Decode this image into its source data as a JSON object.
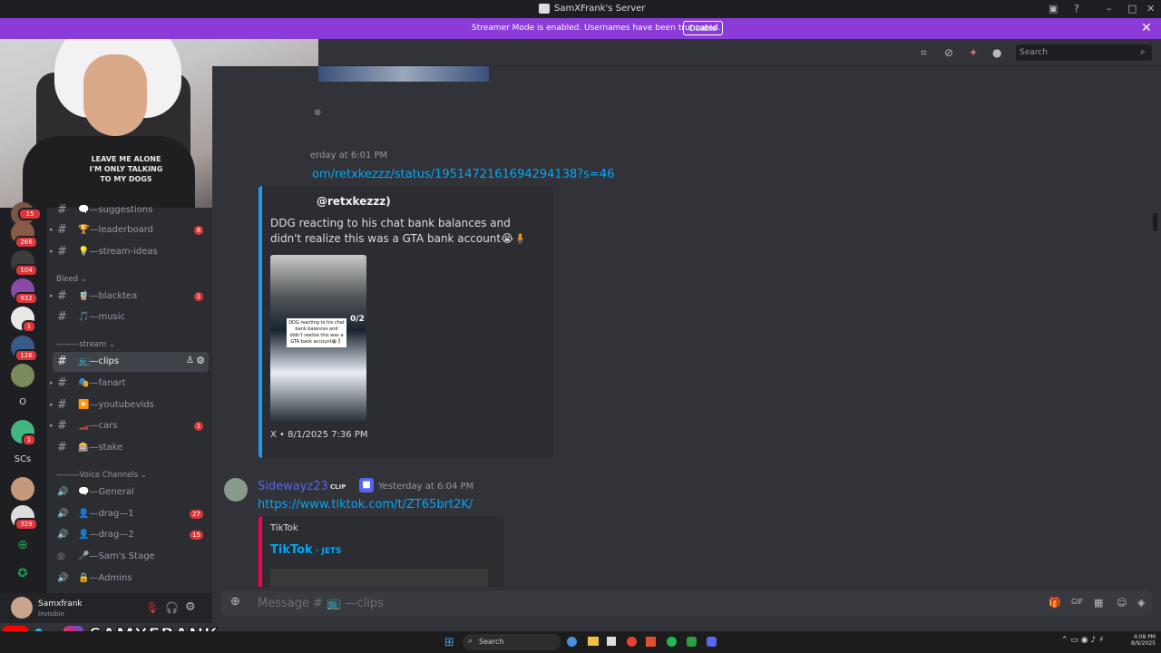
{
  "window": {
    "title": "SamXFrank's Server"
  },
  "banner": {
    "message": "Streamer Mode is enabled. Usernames have been truncated.",
    "button": "Disable"
  },
  "topbar": {
    "search_placeholder": "Search"
  },
  "servers": [
    {
      "badge": "15"
    },
    {
      "badge": "266"
    },
    {
      "badge": "104"
    },
    {
      "badge": "932"
    },
    {
      "badge": "1"
    },
    {
      "badge": "126"
    },
    {
      "badge": ""
    },
    {
      "label": "O"
    },
    {
      "badge": "1"
    },
    {
      "label": "SCs"
    },
    {
      "badge": ""
    },
    {
      "badge": "329"
    }
  ],
  "channels": [
    {
      "name": "🗨️—suggestions",
      "badge": ""
    },
    {
      "name": "🏆—leaderboard",
      "badge": "8"
    },
    {
      "name": "💡—stream-ideas",
      "badge": ""
    },
    {
      "name": "🧋—blacktea",
      "badge": "1"
    },
    {
      "name": "🎵—music",
      "badge": ""
    },
    {
      "name": "📺—clips",
      "badge": ""
    },
    {
      "name": "🎭—fanart",
      "badge": ""
    },
    {
      "name": "▶️—youtubevids",
      "badge": ""
    },
    {
      "name": "🏎️—cars",
      "badge": "1"
    },
    {
      "name": "🎰—stake",
      "badge": ""
    }
  ],
  "categories": {
    "bleed": "Bleed",
    "stream": "———stream",
    "voice": "———Voice Channels"
  },
  "voice": [
    {
      "name": "🗨️—General",
      "badge": ""
    },
    {
      "name": "👤—drag—1",
      "badge": "27"
    },
    {
      "name": "👤—drag—2",
      "badge": "15"
    },
    {
      "name": "🎤—Sam's Stage",
      "badge": ""
    },
    {
      "name": "🔒—Admins",
      "badge": ""
    }
  ],
  "user": {
    "name": "Samxfrank",
    "status": "Invisible"
  },
  "messages": {
    "m1": {
      "time": "erday at 6:01 PM",
      "link": "om/retxkezzz/status/1951472161694294138?s=46",
      "embed_author": "@retxkezzz)",
      "embed_text": "DDG reacting to his chat bank balances and didn't realize this was a GTA bank account😭🧍",
      "footer": "X • 8/1/2025 7:36 PM"
    },
    "m2": {
      "user": "Sidewayz23",
      "tag": "CLIP",
      "time": "Yesterday at 6:04 PM",
      "link": "https://www.tiktok.com/t/ZT65brt2K/",
      "provider": "TikTok",
      "embed_title": "TikTok",
      "embed_sub": " · JETS"
    }
  },
  "thumb_caption": "DDG reacting to his chat bank balances and didn't realize this was a GTA bank account😭🧍",
  "thumb_counter": "0/2",
  "composer": {
    "placeholder": "Message # 📺 —clips"
  },
  "taskbar": {
    "search": "Search",
    "time": "4:08 PM",
    "date": "8/9/2025"
  },
  "overlay": {
    "handle": "SAMXFRANK",
    "shirt": "LEAVE ME ALONE I'M ONLY TALKING TO MY DOGS"
  }
}
